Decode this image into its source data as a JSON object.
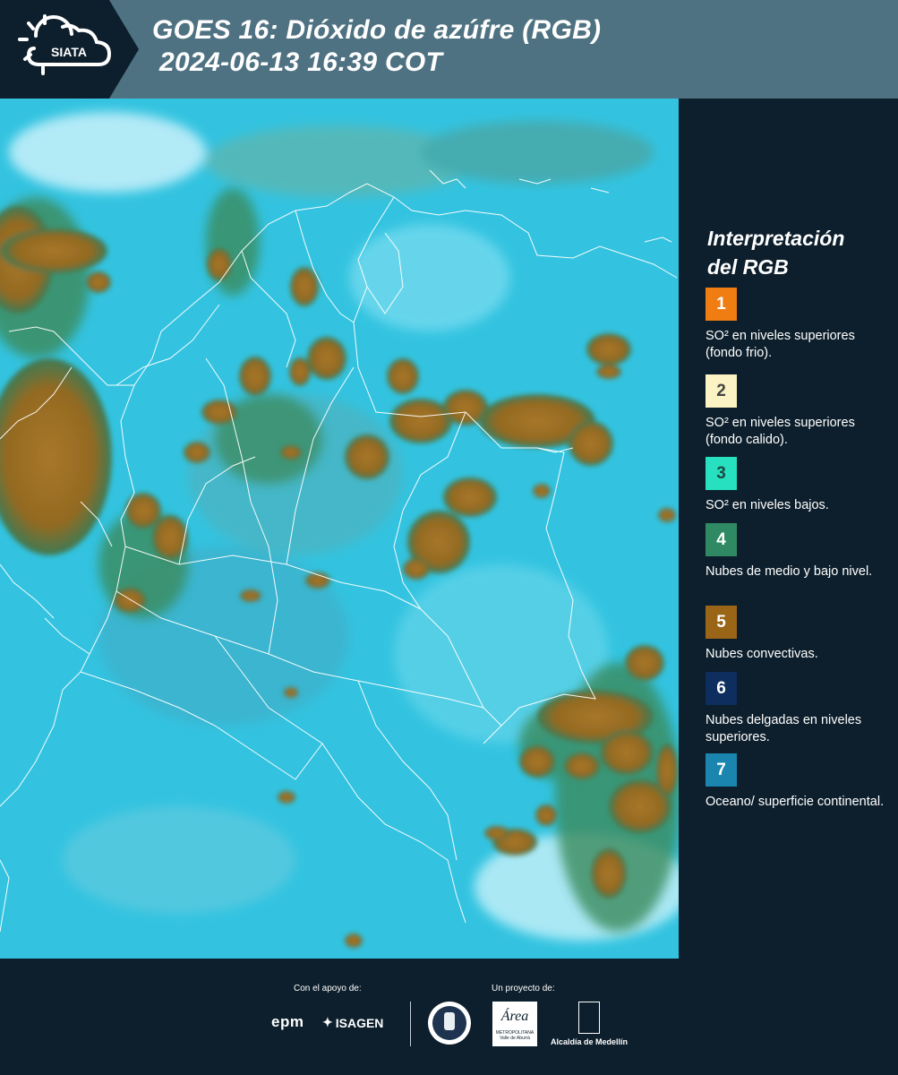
{
  "header": {
    "logo_text": "SIATA",
    "title_line1": "GOES 16: Dióxido de azúfre (RGB)",
    "title_line2": "2024-06-13 16:39 COT"
  },
  "legend": {
    "title_line1": "Interpretación",
    "title_line2": "del RGB",
    "items": [
      {
        "num": "1",
        "color": "#f07d12",
        "text_color": "#ffffff",
        "label": "SO² en niveles superiores (fondo frio)."
      },
      {
        "num": "2",
        "color": "#fbf3c4",
        "text_color": "#444444",
        "label": "SO² en niveles superiores (fondo calido)."
      },
      {
        "num": "3",
        "color": "#27e0c0",
        "text_color": "#1d4a44",
        "label": "SO² en niveles bajos."
      },
      {
        "num": "4",
        "color": "#2f8a63",
        "text_color": "#ffffff",
        "label": "Nubes de medio y bajo nivel."
      },
      {
        "num": "5",
        "color": "#9a6516",
        "text_color": "#ffffff",
        "label": "Nubes convectivas."
      },
      {
        "num": "6",
        "color": "#0d2e5e",
        "text_color": "#ffffff",
        "label": "Nubes delgadas en niveles superiores."
      },
      {
        "num": "7",
        "color": "#1a86b0",
        "text_color": "#ffffff",
        "label": "Oceano/ superficie continental."
      }
    ]
  },
  "footer": {
    "support_label": "Con el apoyo de:",
    "project_label": "Un proyecto de:",
    "epm_text": "epm",
    "isagen_text": "ISAGEN",
    "area_text": "Área",
    "area_sub": "METROPOLITANA",
    "area_sub2": "Valle de Aburrá",
    "alcaldia_text": "Alcaldía de Medellín"
  },
  "colors": {
    "header_bg": "#4f7282",
    "page_bg": "#0d1f2c",
    "ocean_cyan": "#2fc6e4",
    "convective_brown": "#9a6a22",
    "boundary_white": "#ffffff"
  }
}
